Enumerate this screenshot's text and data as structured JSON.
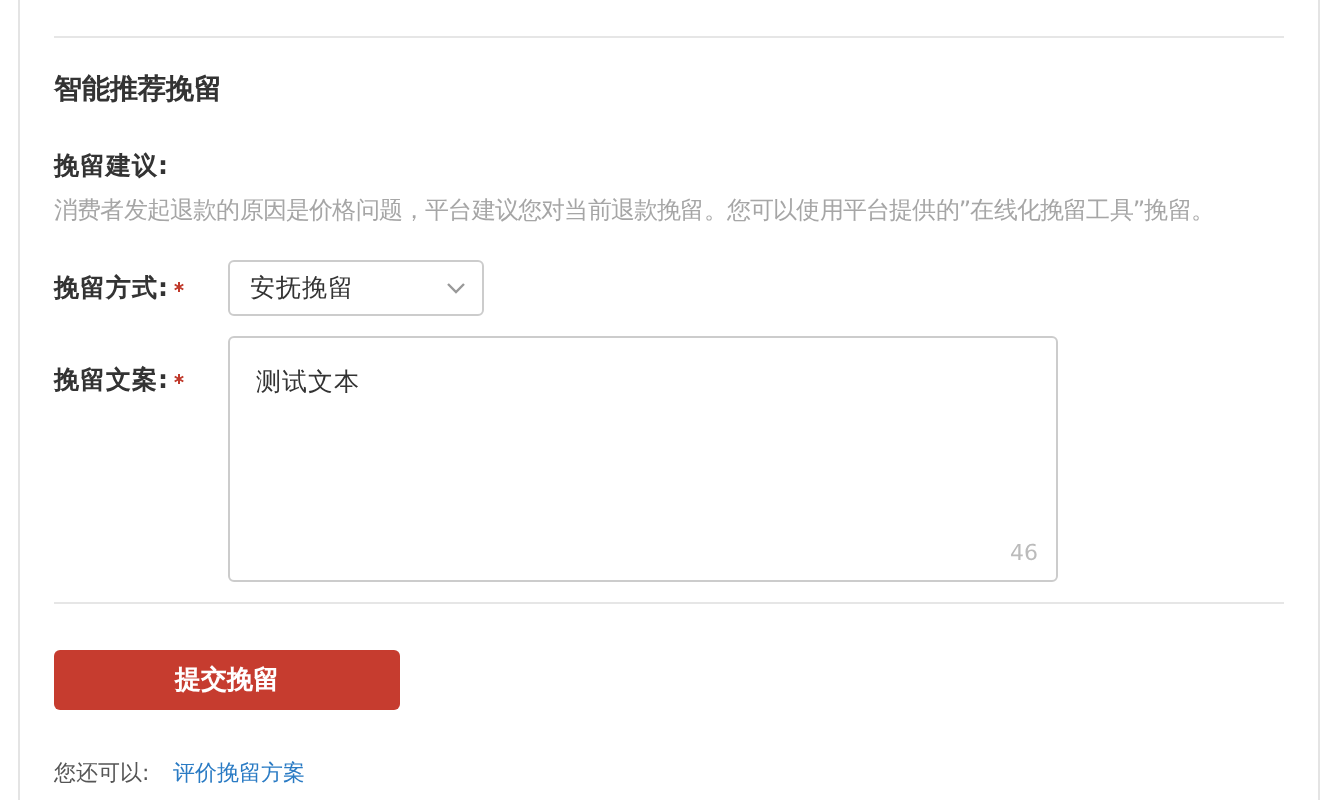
{
  "section": {
    "title": "智能推荐挽留"
  },
  "advice": {
    "label": "挽留建议:",
    "text": "消费者发起退款的原因是价格问题，平台建议您对当前退款挽留。您可以使用平台提供的”在线化挽留工具”挽留。"
  },
  "method": {
    "label": "挽留方式:",
    "required": true,
    "value": "安抚挽留"
  },
  "copy": {
    "label": "挽留文案:",
    "required": true,
    "value": "测试文本",
    "counter": "46"
  },
  "submit": {
    "label": "提交挽留"
  },
  "footer": {
    "prefix": "您还可以:",
    "link": "评价挽留方案"
  }
}
